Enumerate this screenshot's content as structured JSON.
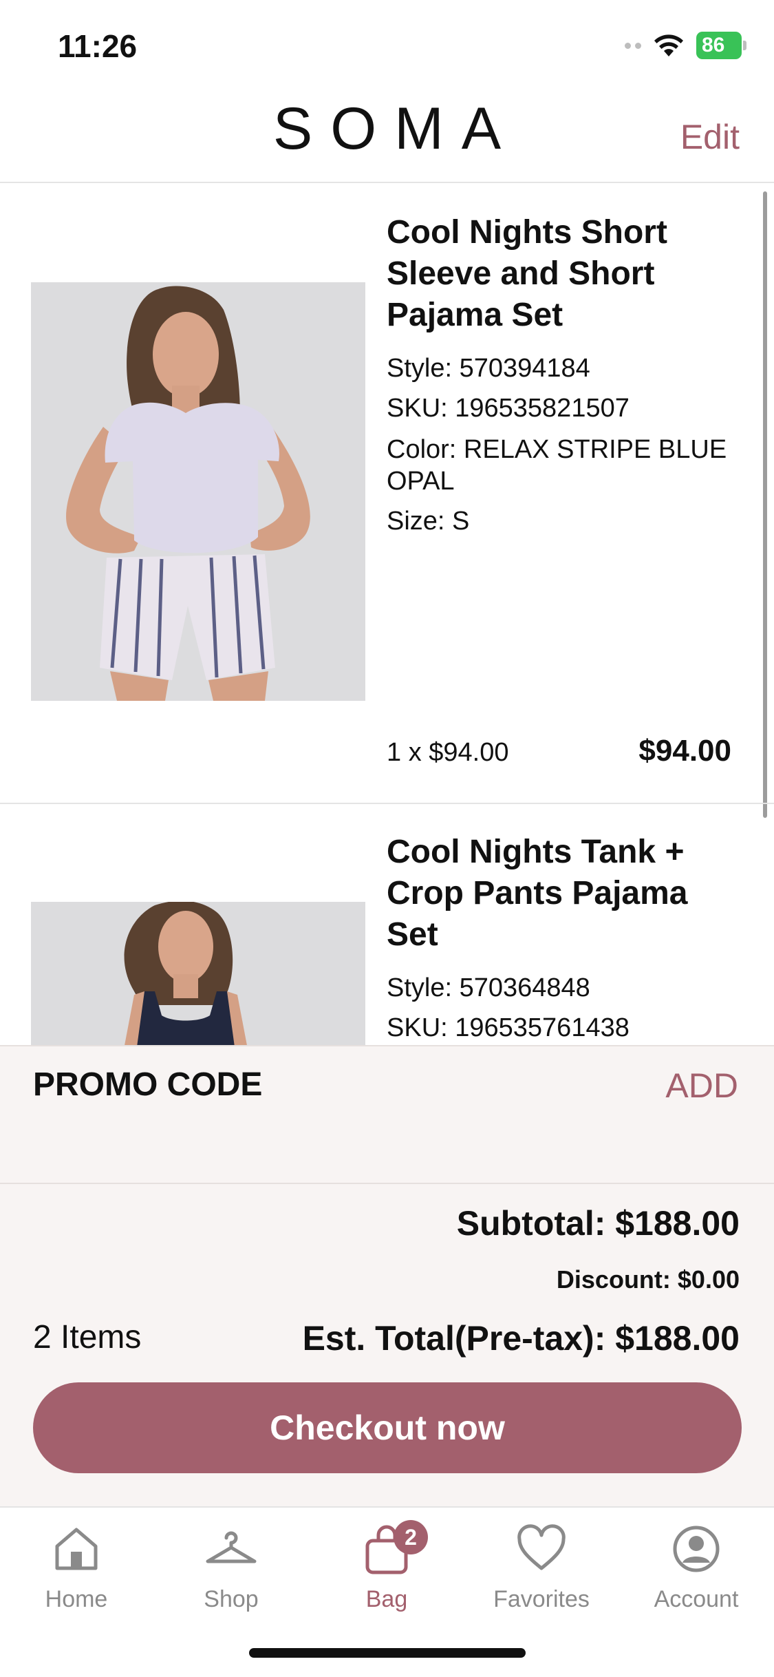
{
  "status_bar": {
    "time": "11:26",
    "battery": "86"
  },
  "header": {
    "brand": "SOMA",
    "edit_label": "Edit"
  },
  "cart": {
    "items": [
      {
        "name": "Cool Nights Short Sleeve and Short Pajama Set",
        "style": "Style: 570394184",
        "sku": "SKU: 196535821507",
        "color": "Color: RELAX STRIPE BLUE OPAL",
        "size": "Size: S",
        "qty_price": "1 x $94.00",
        "line_total": "$94.00"
      },
      {
        "name": "Cool Nights Tank + Crop Pants Pajama Set",
        "style": "Style: 570364848",
        "sku": "SKU: 196535761438"
      }
    ]
  },
  "promo": {
    "label": "PROMO CODE",
    "action": "ADD"
  },
  "summary": {
    "subtotal": "Subtotal: $188.00",
    "discount": "Discount: $0.00",
    "item_count": "2 Items",
    "est_total": "Est. Total(Pre-tax): $188.00",
    "checkout_label": "Checkout now"
  },
  "tab_bar": {
    "tabs": [
      {
        "label": "Home",
        "icon": "home-icon"
      },
      {
        "label": "Shop",
        "icon": "hanger-icon"
      },
      {
        "label": "Bag",
        "icon": "bag-icon",
        "badge": "2",
        "active": true
      },
      {
        "label": "Favorites",
        "icon": "heart-icon"
      },
      {
        "label": "Account",
        "icon": "account-icon"
      }
    ]
  },
  "colors": {
    "accent": "#a3606d",
    "panel_bg": "#f8f4f3",
    "battery": "#39c257"
  }
}
